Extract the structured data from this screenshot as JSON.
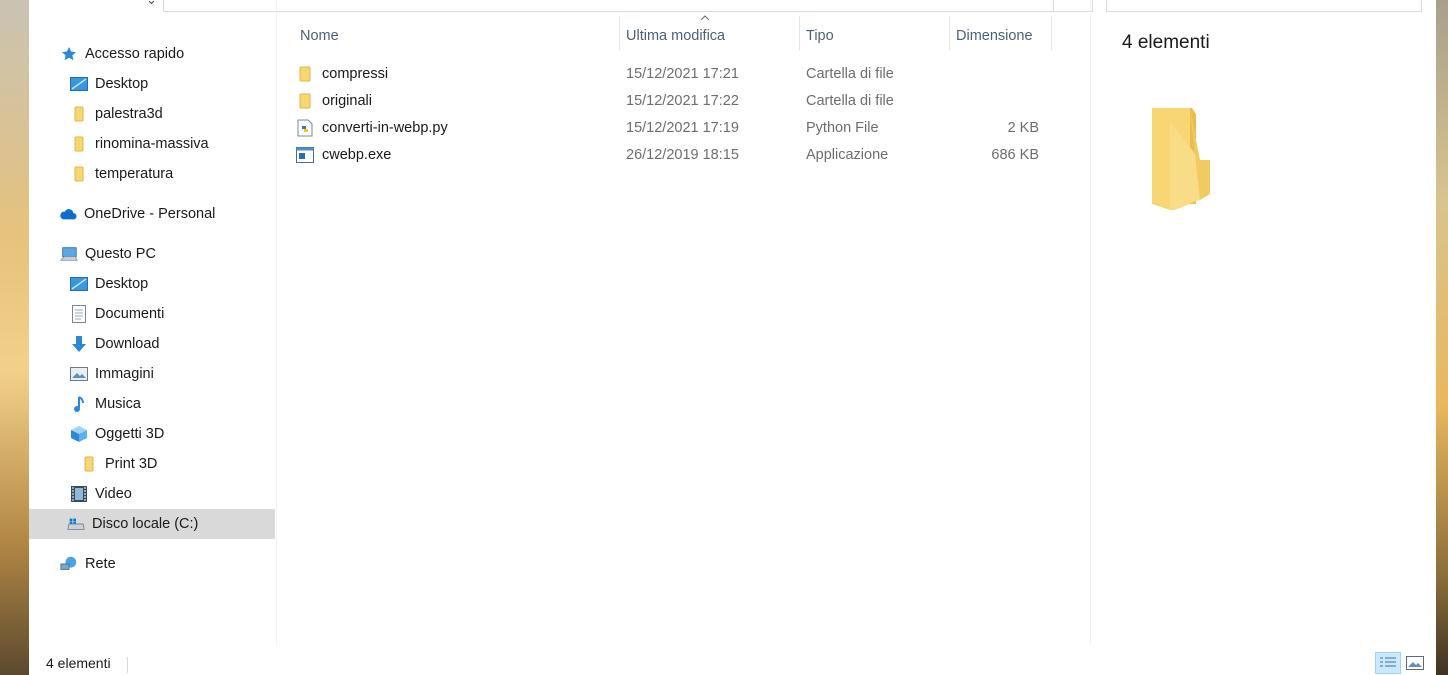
{
  "nav": {
    "quick_access": "Accesso rapido",
    "quick_items": [
      "Desktop",
      "palestra3d",
      "rinomina-massiva",
      "temperatura"
    ],
    "onedrive": "OneDrive - Personal",
    "this_pc": "Questo PC",
    "pc_items": [
      "Desktop",
      "Documenti",
      "Download",
      "Immagini",
      "Musica",
      "Oggetti 3D",
      "Print 3D",
      "Video",
      "Disco locale (C:)"
    ],
    "network": "Rete"
  },
  "columns": {
    "name": "Nome",
    "modified": "Ultima modifica",
    "type": "Tipo",
    "size": "Dimensione"
  },
  "files": [
    {
      "name": "compressi",
      "modified": "15/12/2021 17:21",
      "type": "Cartella di file",
      "size": "",
      "icon": "folder-icon"
    },
    {
      "name": "originali",
      "modified": "15/12/2021 17:22",
      "type": "Cartella di file",
      "size": "",
      "icon": "folder-icon"
    },
    {
      "name": "converti-in-webp.py",
      "modified": "15/12/2021 17:19",
      "type": "Python File",
      "size": "2 KB",
      "icon": "python-file-icon"
    },
    {
      "name": "cwebp.exe",
      "modified": "26/12/2019 18:15",
      "type": "Applicazione",
      "size": "686 KB",
      "icon": "application-icon"
    }
  ],
  "details": {
    "count": "4 elementi"
  },
  "status": {
    "count": "4 elementi"
  },
  "colors": {
    "folder": "#f7d673",
    "accent": "#0078d7",
    "selected_nav": "#d9d9d9",
    "header_text": "#4c607a"
  }
}
